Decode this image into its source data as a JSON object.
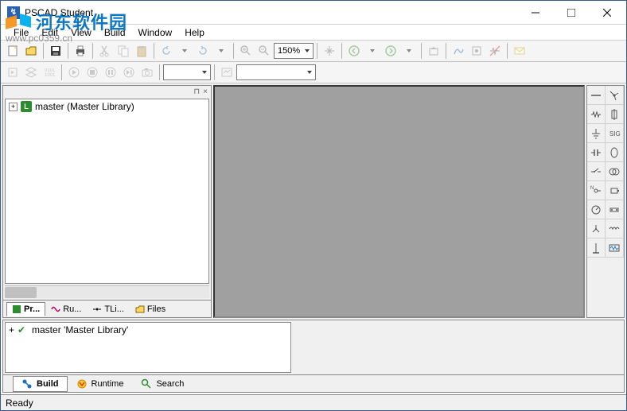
{
  "title": "PSCAD Student",
  "watermark": {
    "text": "河东软件园",
    "url": "www.pc0359.cn"
  },
  "menu": {
    "file": "File",
    "edit": "Edit",
    "view": "View",
    "build": "Build",
    "window": "Window",
    "help": "Help"
  },
  "toolbar": {
    "zoom": "150%"
  },
  "tree": {
    "root": "master (Master Library)"
  },
  "project_tabs": {
    "projects": "Pr...",
    "runtime": "Ru...",
    "tline": "TLi...",
    "files": "Files"
  },
  "bottom_tree": {
    "root": "master 'Master Library'"
  },
  "bottom_tabs": {
    "build": "Build",
    "runtime": "Runtime",
    "search": "Search"
  },
  "status": "Ready"
}
